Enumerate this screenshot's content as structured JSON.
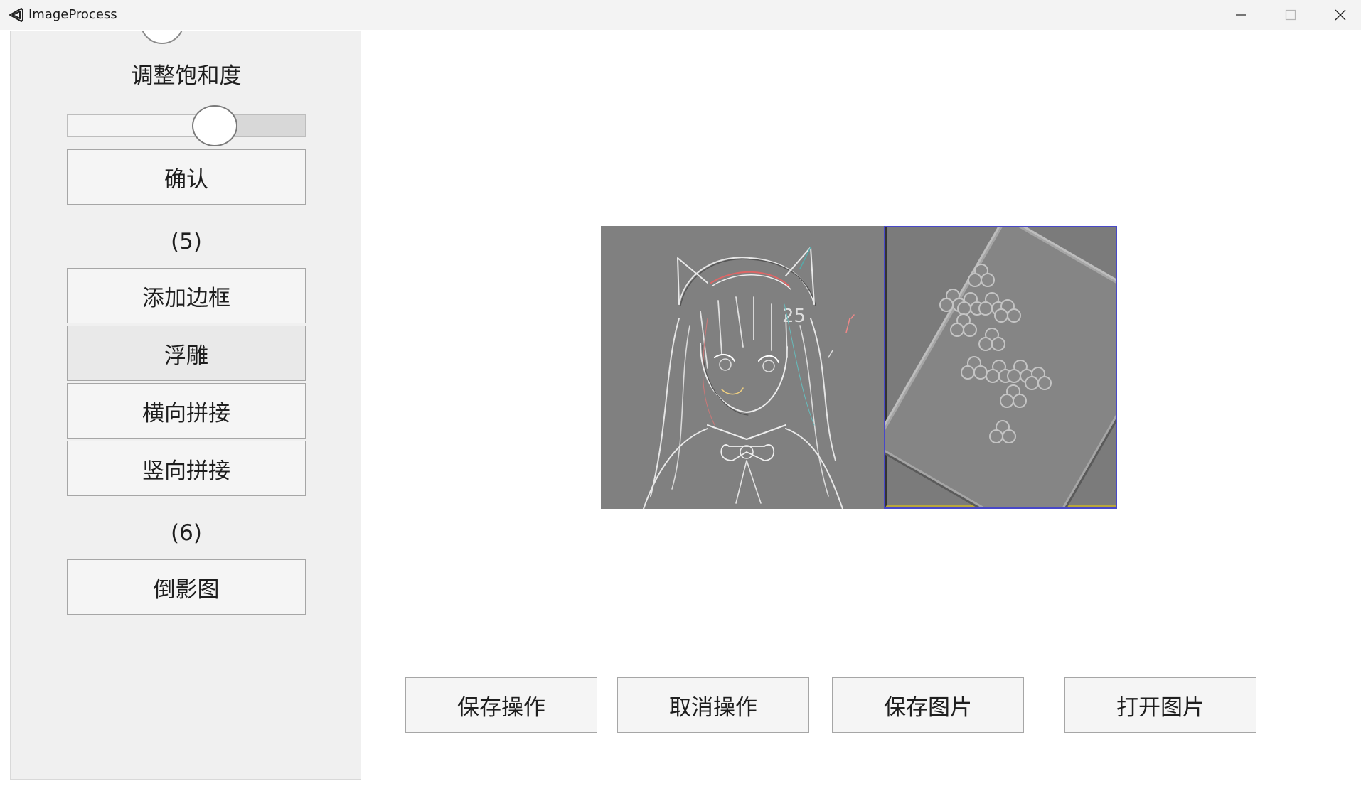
{
  "window": {
    "title": "ImageProcess",
    "minimize_glyph": "─",
    "maximize_glyph": "☐",
    "close_glyph": "✕"
  },
  "sidebar": {
    "saturation_label": "调整饱和度",
    "saturation_slider_level_percent": 62,
    "confirm_label": "确认",
    "step5_label": "(5)",
    "add_border_label": "添加边框",
    "emboss_label": "浮雕",
    "horizontal_join_label": "横向拼接",
    "vertical_join_label": "竖向拼接",
    "step6_label": "(6)",
    "reflection_label": "倒影图"
  },
  "toolbar": {
    "save_op_label": "保存操作",
    "cancel_op_label": "取消操作",
    "save_image_label": "保存图片",
    "open_image_label": "打开图片"
  },
  "colors": {
    "panel_bg": "#f0f0f0",
    "button_bg": "#f5f5f5",
    "button_border": "#a6a6a6",
    "emboss_gray": "#808080",
    "selection_border": "#4848c8"
  },
  "icons": {
    "app": "visual-studio-logo-icon",
    "minimize": "minimize-icon",
    "maximize": "maximize-icon",
    "close": "close-icon"
  }
}
